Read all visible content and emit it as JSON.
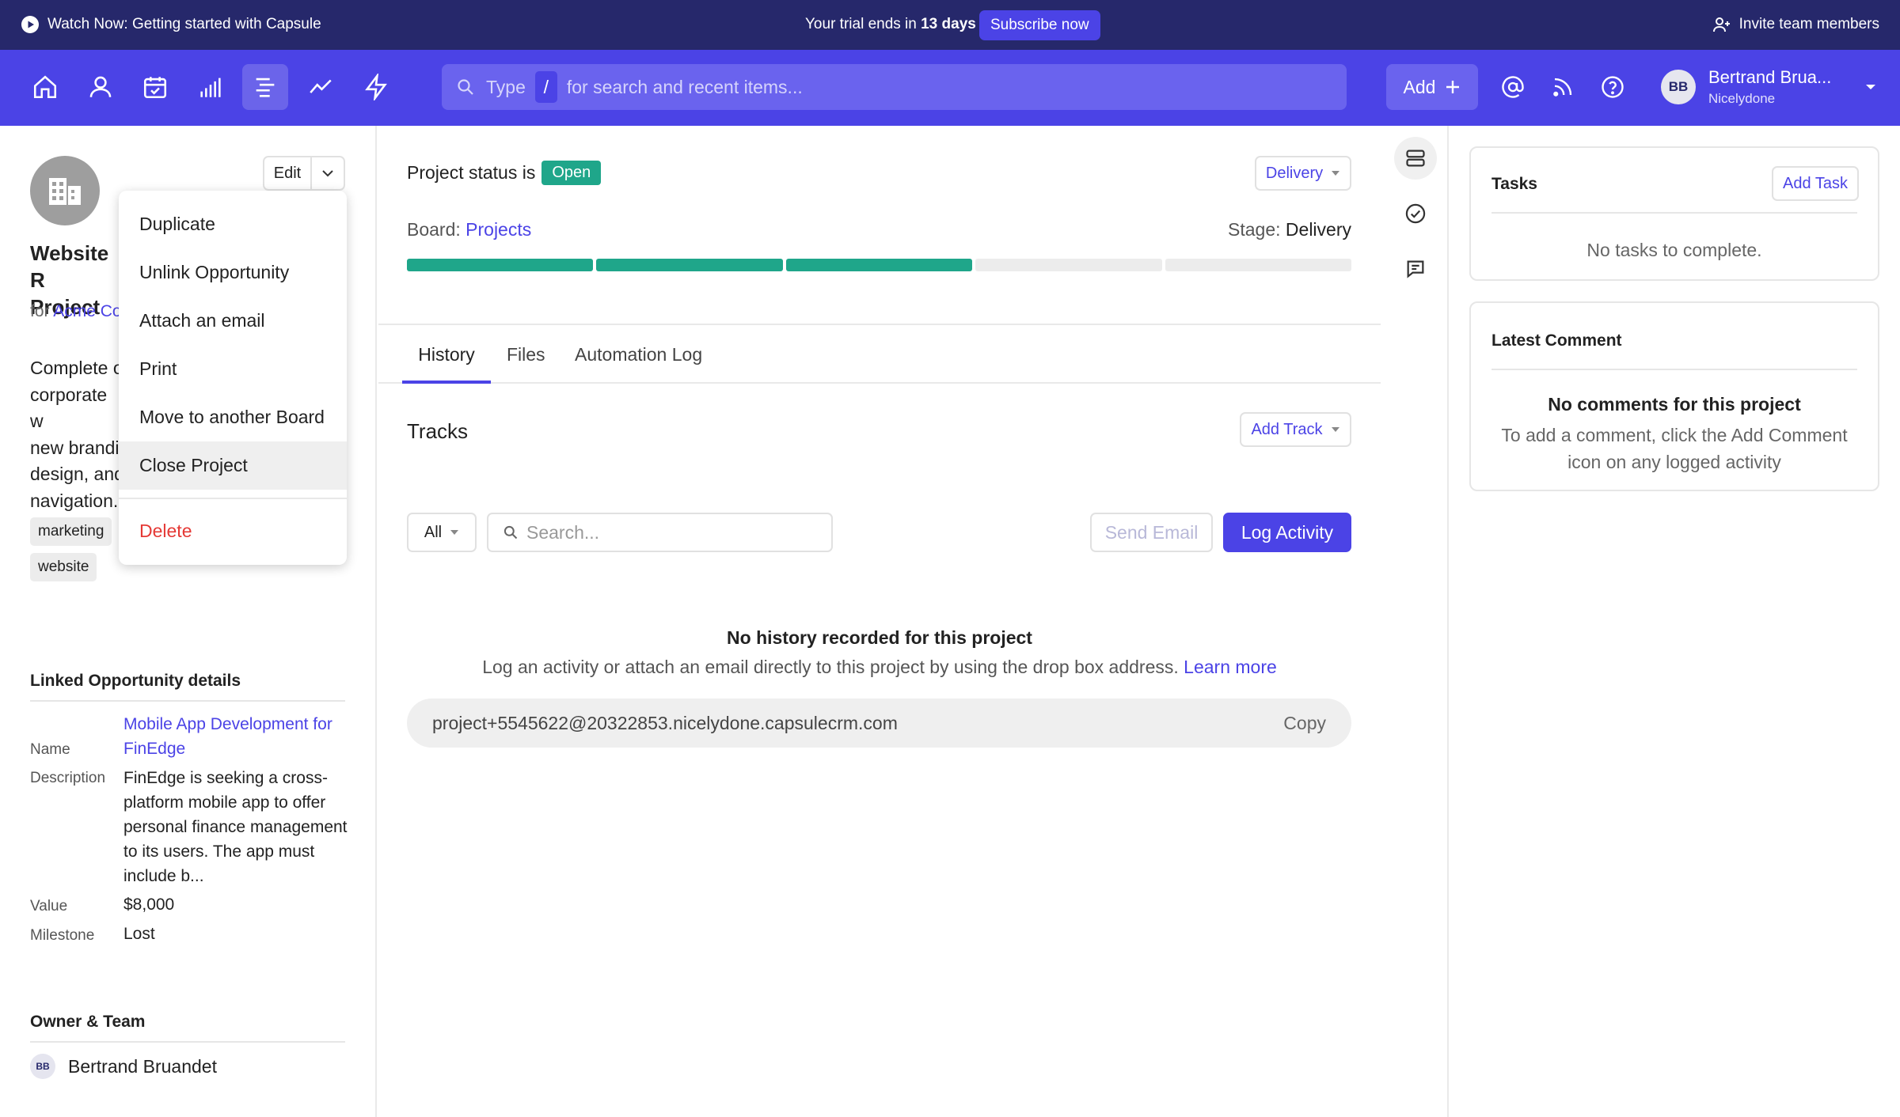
{
  "topbar": {
    "watch_label": "Watch Now: Getting started with Capsule",
    "trial_prefix": "Your trial ends in ",
    "trial_days": "13 days",
    "subscribe_label": "Subscribe now",
    "invite_label": "Invite team members"
  },
  "navbar": {
    "search_prefix": "Type",
    "search_key": "/",
    "search_suffix": "for search and recent items...",
    "add_label": "Add",
    "user_name": "Bertrand Brua...",
    "user_company": "Nicelydone",
    "user_initials": "BB"
  },
  "left": {
    "edit_label": "Edit",
    "title_line1": "Website R",
    "title_line2": "Project",
    "for_prefix": "for ",
    "for_link": "Acme Co",
    "desc_lines": [
      "Complete o",
      "corporate w",
      "new brandi",
      "design, and",
      "navigation."
    ],
    "tags": [
      "marketing",
      "website"
    ],
    "dropdown": {
      "duplicate": "Duplicate",
      "unlink": "Unlink Opportunity",
      "attach": "Attach an email",
      "print": "Print",
      "move": "Move to another Board",
      "close": "Close Project",
      "delete": "Delete"
    },
    "linked_header": "Linked Opportunity details",
    "name_label": "Name",
    "name_value": "Mobile App Development for FinEdge",
    "desc_label": "Description",
    "desc_value": "FinEdge is seeking a cross-platform mobile app to offer personal finance management to its users. The app must include b...",
    "value_label": "Value",
    "value_value": "$8,000",
    "milestone_label": "Milestone",
    "milestone_value": "Lost",
    "owner_header": "Owner & Team",
    "owner_initials": "BB",
    "owner_name": "Bertrand Bruandet"
  },
  "center": {
    "status_prefix": "Project status is",
    "status_badge": "Open",
    "delivery_label": "Delivery",
    "board_prefix": "Board:",
    "board_link": "Projects",
    "stage_prefix": "Stage:",
    "stage_value": "Delivery",
    "stages_completed": 3,
    "stages_total": 5,
    "tabs": {
      "history": "History",
      "files": "Files",
      "automation": "Automation Log"
    },
    "tracks_title": "Tracks",
    "add_track_label": "Add Track",
    "filter_label": "All",
    "search_placeholder": "Search...",
    "send_email_label": "Send Email",
    "log_activity_label": "Log Activity",
    "empty_title": "No history recorded for this project",
    "empty_text": "Log an activity or attach an email directly to this project by using the drop box address.",
    "learn_more": "Learn more",
    "dropbox_email": "project+5545622@20322853.nicelydone.capsulecrm.com",
    "copy_label": "Copy"
  },
  "right": {
    "tasks_title": "Tasks",
    "add_task_label": "Add Task",
    "tasks_empty": "No tasks to complete.",
    "comment_title": "Latest Comment",
    "comment_empty_title": "No comments for this project",
    "comment_empty_text": "To add a comment, click the Add Comment icon on any logged activity"
  },
  "colors": {
    "primary": "#4b43e6",
    "topbar": "#26286b",
    "progress_done": "#1fa68a",
    "progress_todo": "#ececec",
    "danger": "#e53935"
  }
}
